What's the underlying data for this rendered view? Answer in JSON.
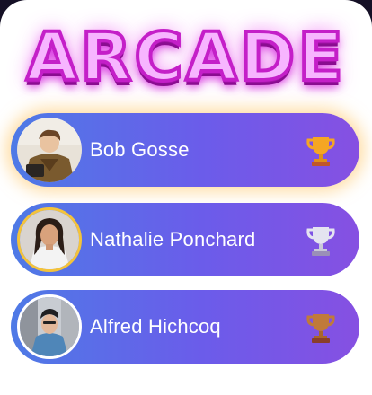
{
  "header": {
    "title": "ARCADE"
  },
  "players": [
    {
      "name": "Bob Gosse",
      "trophy": "gold-trophy-icon",
      "trophy_color": "#f5a623"
    },
    {
      "name": "Nathalie Ponchard",
      "trophy": "silver-trophy-icon",
      "trophy_color": "#e4e4f0"
    },
    {
      "name": "Alfred Hichcoq",
      "trophy": "bronze-trophy-icon",
      "trophy_color": "#c07a3a"
    }
  ]
}
